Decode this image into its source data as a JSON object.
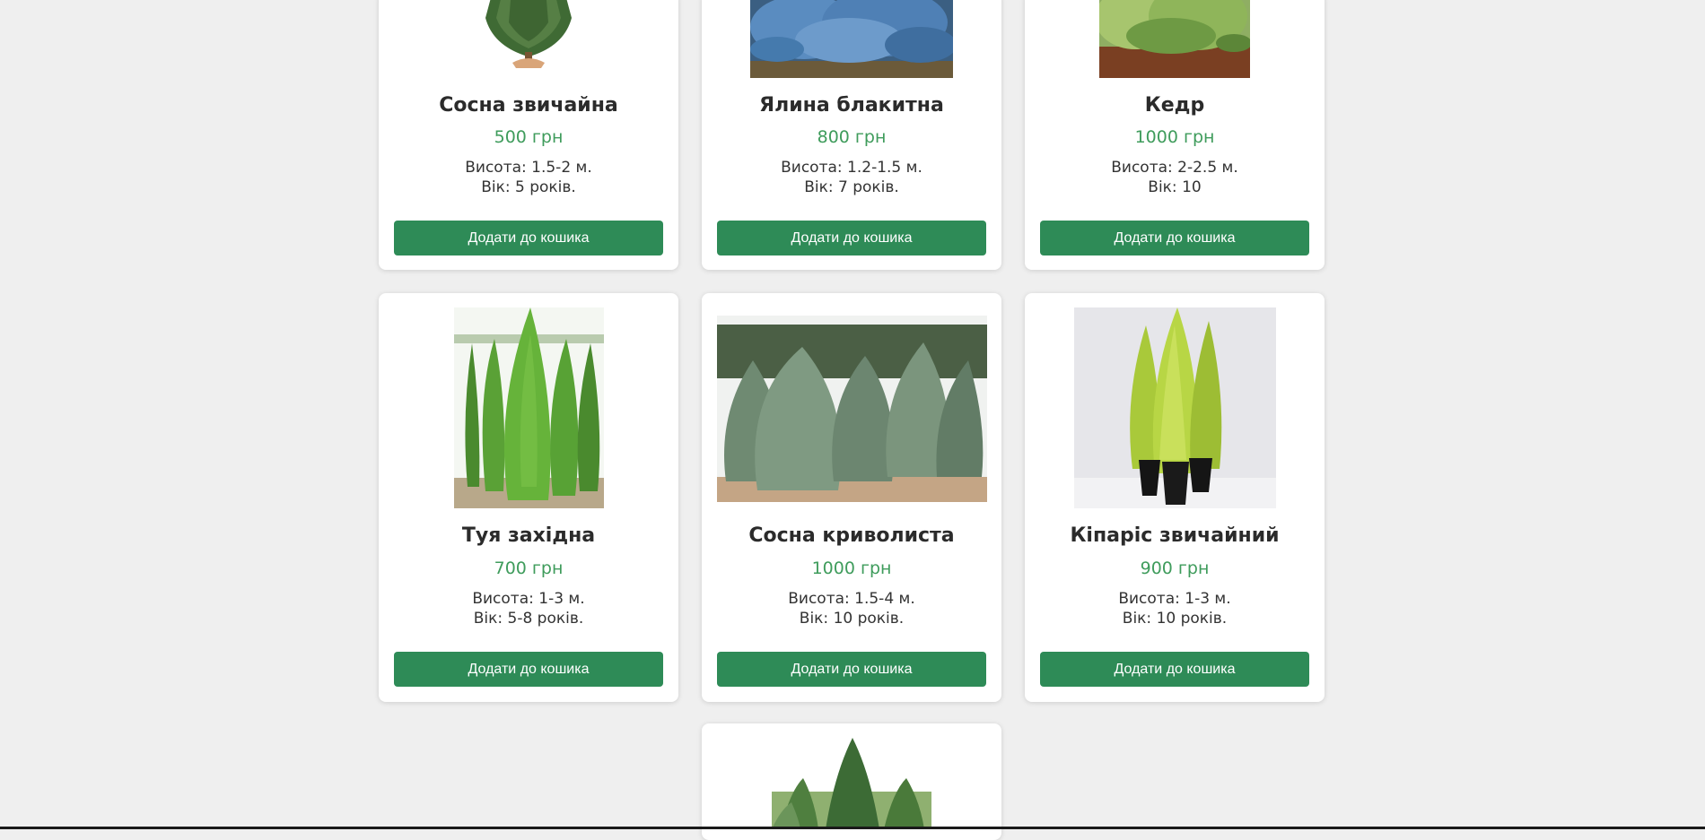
{
  "products": [
    {
      "name": "Сосна звичайна",
      "price": "500 грн",
      "height": "Висота: 1.5-2 м.",
      "age": "Вік: 5 років.",
      "button": "Додати до кошика"
    },
    {
      "name": "Ялина блакитна",
      "price": "800 грн",
      "height": "Висота: 1.2-1.5 м.",
      "age": "Вік: 7 років.",
      "button": "Додати до кошика"
    },
    {
      "name": "Кедр",
      "price": "1000 грн",
      "height": "Висота: 2-2.5 м.",
      "age": "Вік: 10",
      "button": "Додати до кошика"
    },
    {
      "name": "Туя західна",
      "price": "700 грн",
      "height": "Висота: 1-3 м.",
      "age": "Вік: 5-8 років.",
      "button": "Додати до кошика"
    },
    {
      "name": "Сосна криволиста",
      "price": "1000 грн",
      "height": "Висота: 1.5-4 м.",
      "age": "Вік: 10 років.",
      "button": "Додати до кошика"
    },
    {
      "name": "Кіпаріс звичайний",
      "price": "900 грн",
      "height": "Висота: 1-3 м.",
      "age": "Вік: 10 років.",
      "button": "Додати до кошика"
    }
  ],
  "colors": {
    "accent": "#2e8b57",
    "price": "#3f9c5c",
    "background": "#efefef"
  }
}
